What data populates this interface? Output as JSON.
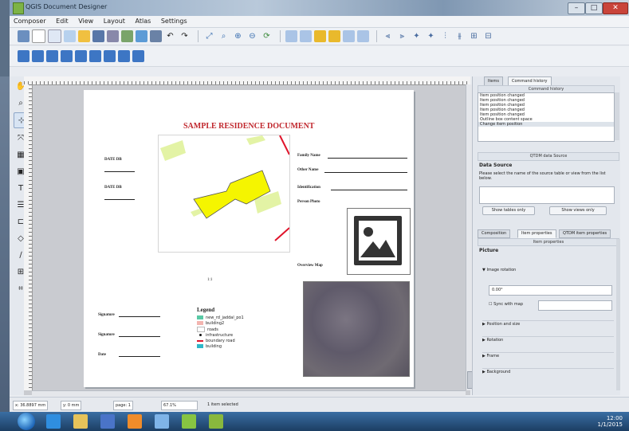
{
  "window": {
    "title": "QGIS Document Designer"
  },
  "menu": [
    "Composer",
    "Edit",
    "View",
    "Layout",
    "Atlas",
    "Settings"
  ],
  "document": {
    "title": "SAMPLE RESIDENCE DOCUMENT",
    "left_labels": [
      "DATE DB",
      "DATE DB"
    ],
    "right_labels": [
      "Family Name",
      "Other Name",
      "Identification",
      "Person Photo"
    ],
    "overview_label": "Overview Map",
    "scale": "1:1",
    "signature_labels": [
      "Signature",
      "Signature",
      "Date"
    ],
    "legend": {
      "title": "Legend",
      "items": [
        {
          "label": "new_rd_jaddal_po1",
          "color": "#59c9a5"
        },
        {
          "label": "building2",
          "color": "#f3b5b0"
        },
        {
          "label": "roads",
          "color": "#ffffff"
        },
        {
          "label": "infrastructure",
          "color": "#111111"
        },
        {
          "label": "boundary road",
          "color": "#e0142b"
        },
        {
          "label": "building",
          "color": "#2fb7c9"
        }
      ]
    }
  },
  "panel": {
    "tabs": [
      "Items",
      "Command history"
    ],
    "command_history_header": "Command history",
    "history": [
      "Item position changed",
      "Item position changed",
      "Item position changed",
      "Item position changed",
      "Item position changed",
      "Outline box content space",
      "Change item position"
    ],
    "table_header": "QTDM data Source",
    "data_source_title": "Data Source",
    "data_source_text": "Please select the name of the source table or view from the list below.",
    "show_tables": "Show tables only",
    "show_views": "Show views only",
    "lower_tabs": [
      "Composition",
      "Item properties",
      "QTDM item properties"
    ],
    "item_props_header": "Item properties",
    "picture_section": "Picture",
    "image_rotation": "Image rotation",
    "rotation_value": "0.00°",
    "sync_with_map": "Sync with map",
    "sections": [
      "Position and size",
      "Rotation",
      "Frame",
      "Background"
    ]
  },
  "statusbar": {
    "x": "x: 36.8897 mm",
    "y": "y: 0 mm",
    "page": "page: 1",
    "zoom": "67.1%",
    "selection": "1 item selected"
  },
  "taskbar": {
    "time": "12:00",
    "date": "1/1/2015"
  },
  "colors": {
    "title_red": "#c0272d",
    "building_yellow": "#f5f500",
    "green_patch": "#e3f3a5"
  }
}
